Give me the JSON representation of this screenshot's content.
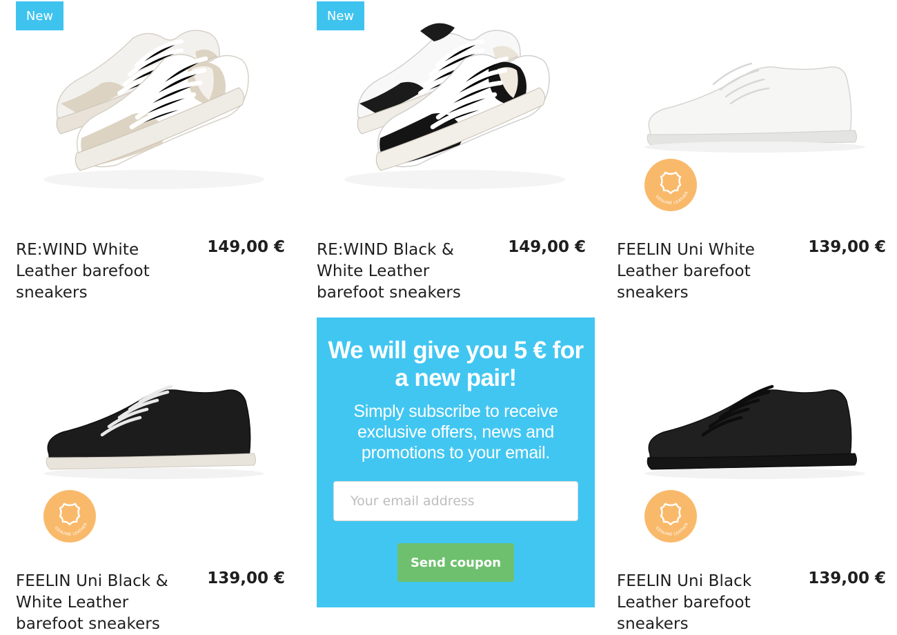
{
  "products": [
    {
      "title": "RE:WIND White Leather barefoot sneakers",
      "price": "149,00 €",
      "badge": "New"
    },
    {
      "title": "RE:WIND Black & White Leather barefoot sneakers",
      "price": "149,00 €",
      "badge": "New"
    },
    {
      "title": "FEELIN Uni White Leather barefoot sneakers",
      "price": "139,00 €",
      "leather_badge": "GENUINE LEATHER"
    },
    {
      "title": "FEELIN Uni Black & White Leather barefoot sneakers",
      "price": "139,00 €",
      "leather_badge": "GENUINE LEATHER"
    },
    {
      "title": "FEELIN Uni Black Leather barefoot sneakers",
      "price": "139,00 €",
      "leather_badge": "GENUINE LEATHER"
    }
  ],
  "promo": {
    "title": "We will give you 5 € for a new pair!",
    "text": "Simply subscribe to receive exclusive offers, news and promotions to your email.",
    "email_placeholder": "Your email address",
    "button_label": "Send coupon"
  },
  "colors": {
    "badge_blue": "#3ec3ef",
    "promo_blue": "#41c6f1",
    "button_green": "#6ec06e",
    "leather_badge_orange": "#f9b96b"
  },
  "icons": [
    "leather-hide-icon"
  ]
}
